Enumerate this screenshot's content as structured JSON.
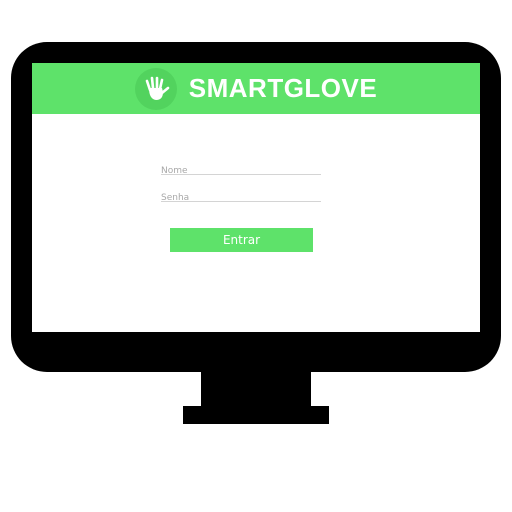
{
  "app": {
    "title": "SMARTGLOVE",
    "logo_icon": "hand-icon"
  },
  "login_form": {
    "name_placeholder": "Nome",
    "password_placeholder": "Senha",
    "submit_label": "Entrar"
  },
  "colors": {
    "accent_green": "#5ee26a",
    "logo_circle": "#52d35e",
    "monitor_bezel": "#000000",
    "screen_background": "#ffffff",
    "field_underline": "#d4d4d4"
  }
}
